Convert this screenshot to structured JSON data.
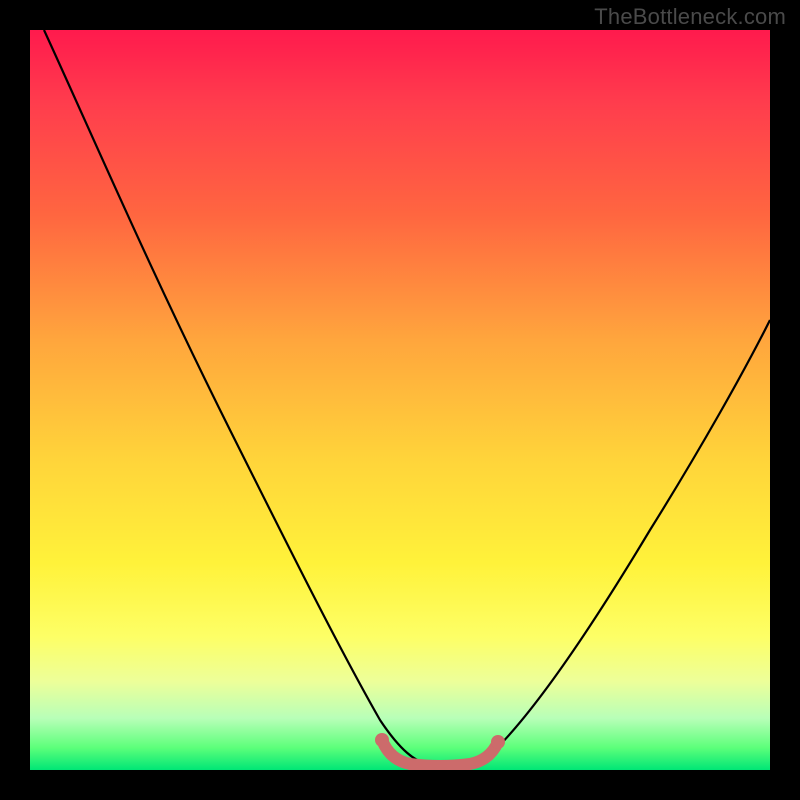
{
  "attribution": "TheBottleneck.com",
  "chart_data": {
    "type": "line",
    "title": "",
    "xlabel": "",
    "ylabel": "",
    "xlim": [
      0,
      100
    ],
    "ylim": [
      0,
      100
    ],
    "grid": false,
    "background_gradient": {
      "top": "#ff1a4d",
      "middle": "#ffd43a",
      "bottom": "#00e676"
    },
    "series": [
      {
        "name": "bottleneck-curve",
        "color": "#000000",
        "x": [
          2,
          10,
          18,
          25,
          32,
          38,
          44,
          48,
          52,
          56,
          58,
          63,
          68,
          74,
          80,
          86,
          92,
          98,
          100
        ],
        "y": [
          100,
          84,
          68,
          54,
          40,
          28,
          18,
          10,
          4,
          2,
          2,
          4,
          10,
          18,
          28,
          38,
          48,
          58,
          62
        ]
      },
      {
        "name": "dip-highlight",
        "color": "#cc6b6b",
        "x": [
          48,
          50,
          52,
          54,
          56,
          58,
          60,
          62,
          63
        ],
        "y": [
          4,
          2,
          1.5,
          1.5,
          1.5,
          1.5,
          2,
          3,
          4
        ]
      }
    ],
    "annotations": []
  }
}
